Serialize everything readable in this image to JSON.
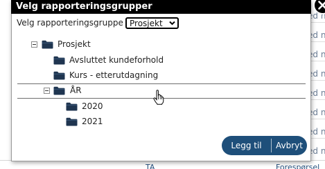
{
  "background": {
    "right_column_cells": [
      "ed n",
      "ed n",
      "ed n",
      "ed n",
      "ed n",
      "ed n",
      "ed n",
      "ed n",
      "ed n"
    ],
    "bottom_row": {
      "left_text": "TA",
      "right_text": "Forespørsel"
    }
  },
  "dialog": {
    "title": "Velg rapporteringsgrupper",
    "close_icon": "close-icon",
    "group_label": "Velg rapporteringsgruppe for",
    "group_select": {
      "value": "Prosjekt",
      "options": [
        "Prosjekt"
      ]
    },
    "tree": {
      "root": {
        "label": "Prosjekt",
        "expanded": true
      },
      "children": [
        {
          "label": "Avsluttet kundeforhold"
        },
        {
          "label": "Kurs - etterutdagning"
        }
      ],
      "year_group": {
        "label": "ÅR",
        "expanded": true,
        "children": [
          {
            "label": "2020"
          },
          {
            "label": "2021"
          }
        ]
      }
    },
    "buttons": {
      "add": "Legg til",
      "cancel": "Avbryt"
    },
    "colors": {
      "titlebar": "#000000",
      "button": "#1e4f7a",
      "folder": "#1f3550"
    }
  }
}
